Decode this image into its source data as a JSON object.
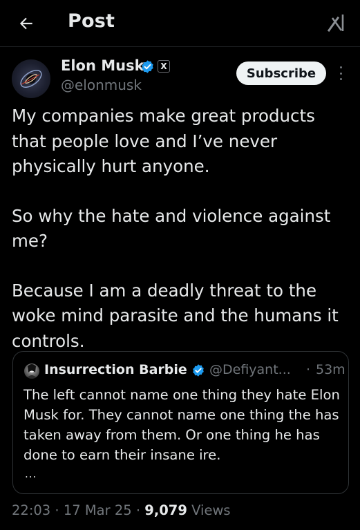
{
  "header": {
    "title": "Post"
  },
  "author": {
    "name": "Elon Musk",
    "handle": "@elonmusk",
    "affiliation_badge": "X"
  },
  "subscribe_label": "Subscribe",
  "post": {
    "paragraphs": [
      "My companies make great products that people love and I’ve never physically hurt anyone.",
      "So why the hate and violence against me?",
      "Because I am a deadly threat to the woke mind parasite and the humans it controls."
    ]
  },
  "quote": {
    "name": "Insurrection Barbie",
    "handle": "@Defiyant...",
    "separator": "·",
    "time": "53m",
    "text": "The left cannot name one thing they hate Elon Musk for. They cannot name one thing the has taken away from them. Or one thing he has done to earn their insane ire.",
    "more": "..."
  },
  "meta": {
    "time": "22:03",
    "date": "17 Mar 25",
    "views_count": "9,079",
    "views_label": "Views",
    "separator": "·"
  },
  "icons": {
    "back": "arrow-left-icon",
    "grok": "grok-icon",
    "verified": "verified-badge-icon",
    "more": "more-vertical-icon"
  },
  "colors": {
    "background": "#000000",
    "text": "#e7e9ea",
    "secondary_text": "#71767b",
    "verified_blue": "#1d9bf0",
    "border": "#2f3336",
    "subscribe_bg": "#eff3f4"
  }
}
